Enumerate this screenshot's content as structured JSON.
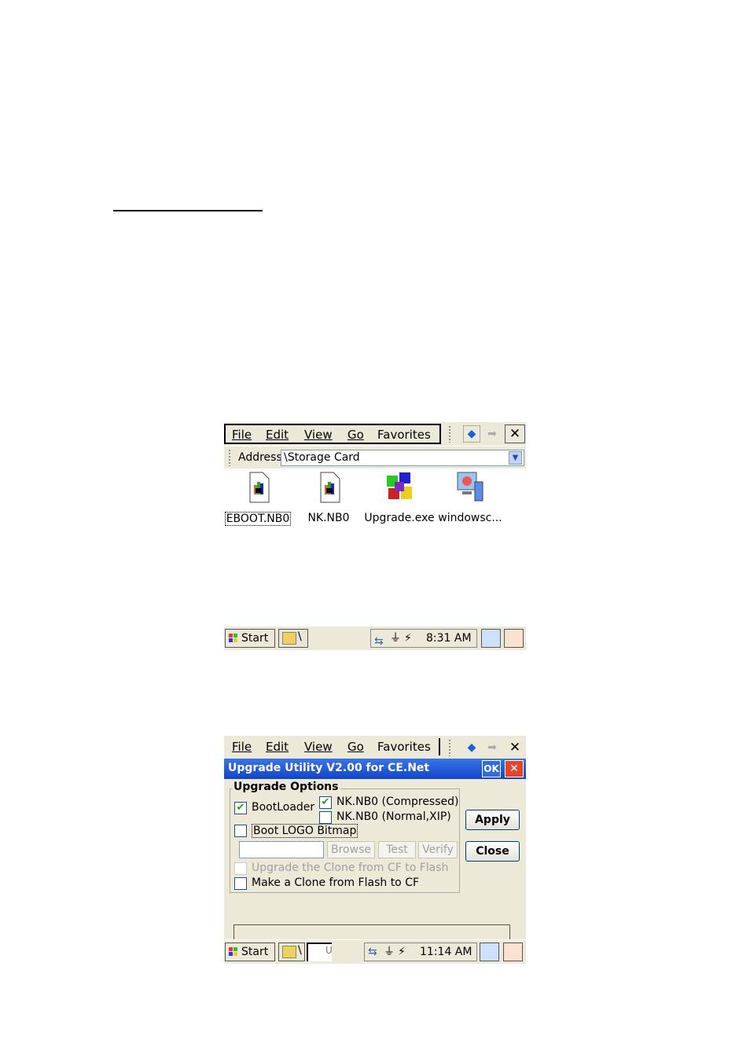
{
  "explorer": {
    "menu": {
      "file": "File",
      "edit": "Edit",
      "view": "View",
      "go": "Go",
      "favorites": "Favorites",
      "close_glyph": "✕"
    },
    "address_label": "Address",
    "address_value": "\\Storage Card",
    "files": [
      {
        "name": "EBOOT.NB0",
        "icon": "binary-file-icon"
      },
      {
        "name": "NK.NB0",
        "icon": "binary-file-icon"
      },
      {
        "name": "Upgrade.exe",
        "icon": "upgrade-app-icon"
      },
      {
        "name": "windowsc...",
        "icon": "computer-icon"
      }
    ],
    "taskbar": {
      "start": "Start",
      "task": "\\",
      "time": "8:31 AM"
    }
  },
  "upgrade": {
    "menu": {
      "file": "File",
      "edit": "Edit",
      "view": "View",
      "go": "Go",
      "favorites": "Favorites",
      "close_glyph": "✕"
    },
    "title": "Upgrade Utility V2.00 for CE.Net",
    "ok": "OK",
    "group_title": "Upgrade Options",
    "bootloader": "BootLoader",
    "nk_compressed": "NK.NB0 (Compressed)",
    "nk_normal": "NK.NB0 (Normal,XIP)",
    "boot_logo": "Boot LOGO Bitmap",
    "browse": "Browse",
    "test": "Test",
    "verify": "Verify",
    "clone_from_cf": "Upgrade the Clone from CF to Flash",
    "make_clone": "Make a Clone from Flash to CF",
    "apply": "Apply",
    "close": "Close",
    "taskbar": {
      "start": "Start",
      "task": "\\",
      "task2": "U",
      "time": "11:14 AM"
    }
  }
}
